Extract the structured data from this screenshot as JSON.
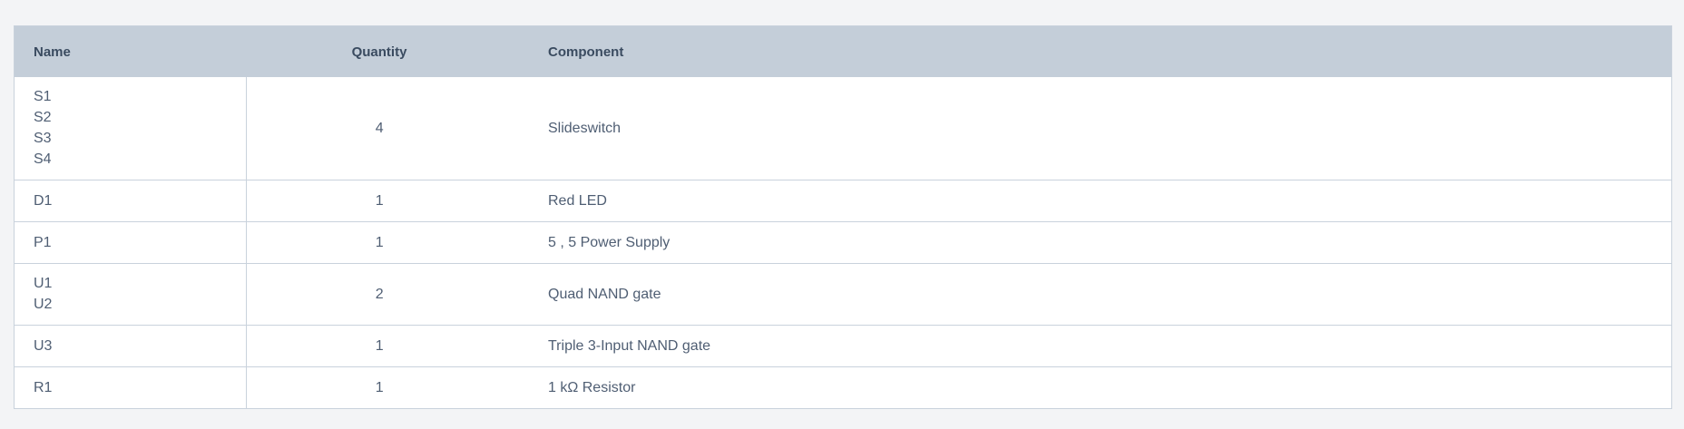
{
  "table": {
    "headers": {
      "name": "Name",
      "quantity": "Quantity",
      "component": "Component"
    },
    "rows": [
      {
        "names": [
          "S1",
          "S2",
          "S3",
          "S4"
        ],
        "quantity": "4",
        "component": "Slideswitch"
      },
      {
        "names": [
          "D1"
        ],
        "quantity": "1",
        "component": "Red LED"
      },
      {
        "names": [
          "P1"
        ],
        "quantity": "1",
        "component": "5 , 5 Power Supply"
      },
      {
        "names": [
          "U1",
          "U2"
        ],
        "quantity": "2",
        "component": "Quad NAND gate"
      },
      {
        "names": [
          "U3"
        ],
        "quantity": "1",
        "component": "Triple 3-Input NAND gate"
      },
      {
        "names": [
          "R1"
        ],
        "quantity": "1",
        "component": "1 kΩ Resistor"
      }
    ]
  },
  "colors": {
    "page_background": "#f3f4f6",
    "header_background": "#c4ced9",
    "border": "#c9d2dc",
    "text": "#4f5e73"
  }
}
